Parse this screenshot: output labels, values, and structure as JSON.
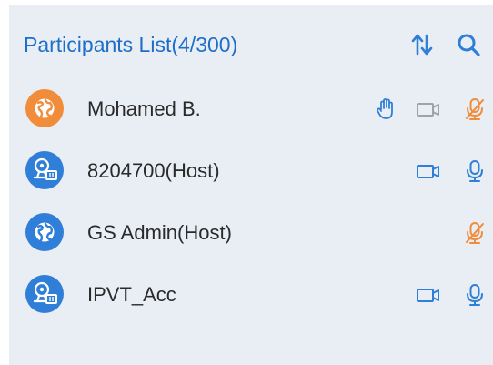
{
  "panel": {
    "title": "Participants List(4/300)",
    "title_color": "#1f6fc8",
    "background": "#e9eef4",
    "header_icons": [
      "sort-icon",
      "search-icon"
    ]
  },
  "colors": {
    "blue": "#2f7fd8",
    "orange": "#f08c3a",
    "muted_gray": "#9aa4ae",
    "icon_blue": "#2f7fd8"
  },
  "participants": [
    {
      "name": "Mohamed B.",
      "avatar": "web-globe-icon",
      "avatar_color": "#f08c3a",
      "hand_raised": true,
      "camera": "off",
      "microphone": "muted"
    },
    {
      "name": "8204700(Host)",
      "avatar": "video-device-icon",
      "avatar_color": "#2f7fd8",
      "hand_raised": false,
      "camera": "on",
      "microphone": "on"
    },
    {
      "name": "GS Admin(Host)",
      "avatar": "web-globe-icon",
      "avatar_color": "#2f7fd8",
      "hand_raised": false,
      "camera": "none",
      "microphone": "muted"
    },
    {
      "name": "IPVT_Acc",
      "avatar": "video-device-icon",
      "avatar_color": "#2f7fd8",
      "hand_raised": false,
      "camera": "on",
      "microphone": "on"
    }
  ]
}
